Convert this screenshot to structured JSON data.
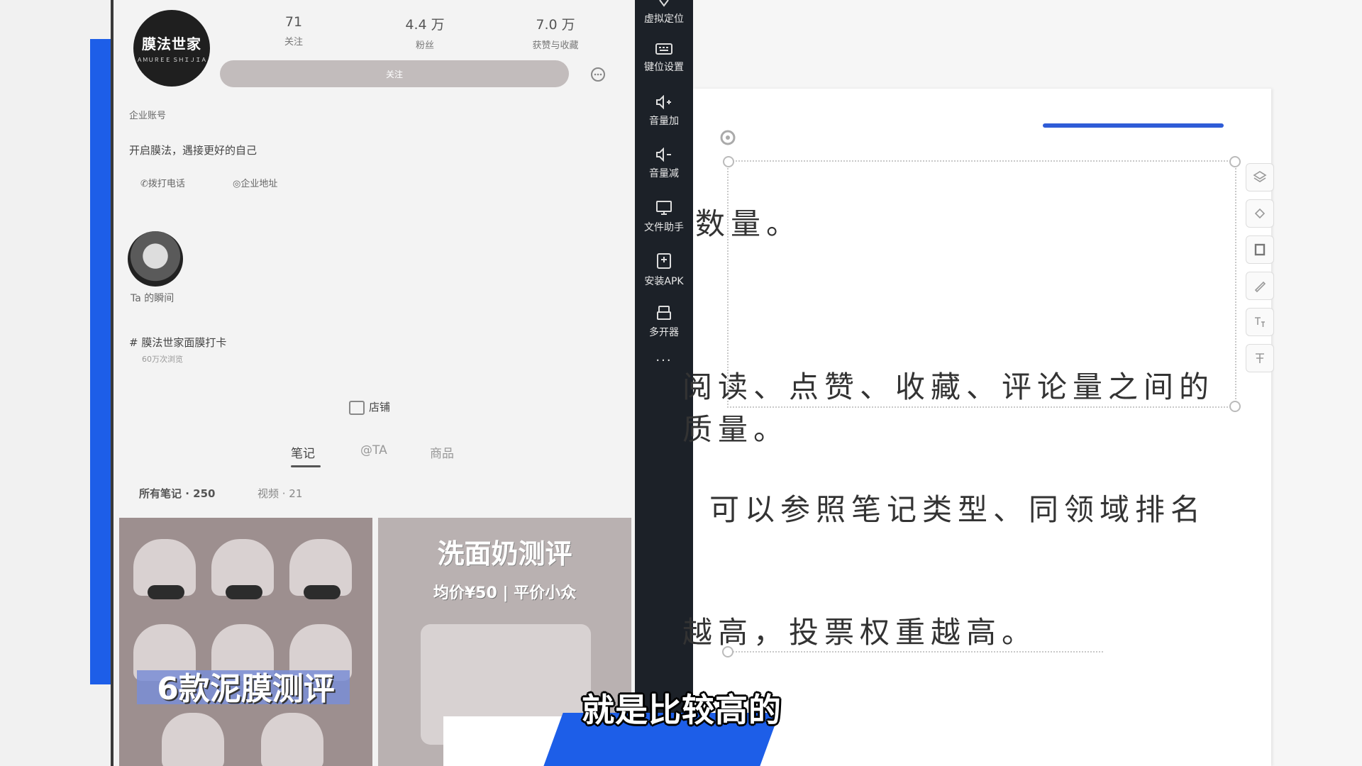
{
  "profile": {
    "avatar_text": "膜法世家",
    "avatar_subtext": "ＡＭＵＲＥＥ ＳＨＩＪＩＡ",
    "stats": [
      {
        "num": "71",
        "label": "关注"
      },
      {
        "num": "4.4 万",
        "label": "粉丝"
      },
      {
        "num": "7.0 万",
        "label": "获赞与收藏"
      }
    ],
    "follow_button": "关注",
    "account_type": "企业账号",
    "bio": "开启膜法，遇接更好的自己",
    "call_label": "拨打电话",
    "address_label": "企业地址",
    "story_label": "Ta 的瞬间",
    "topic_title": "# 膜法世家面膜打卡",
    "topic_views": "60万次浏览",
    "shop_label": "店铺",
    "tabs": [
      "笔记",
      "@TA",
      "商品"
    ],
    "filter_all": "所有笔记 · 250",
    "filter_video": "视频 · 21",
    "card1_title": "6款泥膜测评",
    "card2_title": "洗面奶测评",
    "card2_subtitle": "均价¥50 | 平价小众"
  },
  "toolbar": {
    "items": [
      "虚拟定位",
      "键位设置",
      "音量加",
      "音量减",
      "文件助手",
      "安装APK",
      "多开器"
    ],
    "more": "···"
  },
  "slide": {
    "lines": [
      "数量。",
      "阅读、点赞、收藏、评论量之间的",
      "质量。",
      "可以参照笔记类型、同领域排名",
      "越高，投票权重越高。"
    ]
  },
  "subtitle": "就是比较高的",
  "colors": {
    "accent_blue": "#1d5ee8",
    "toolbar_bg": "#1c2128",
    "slide_line": "#2f5cd7"
  }
}
